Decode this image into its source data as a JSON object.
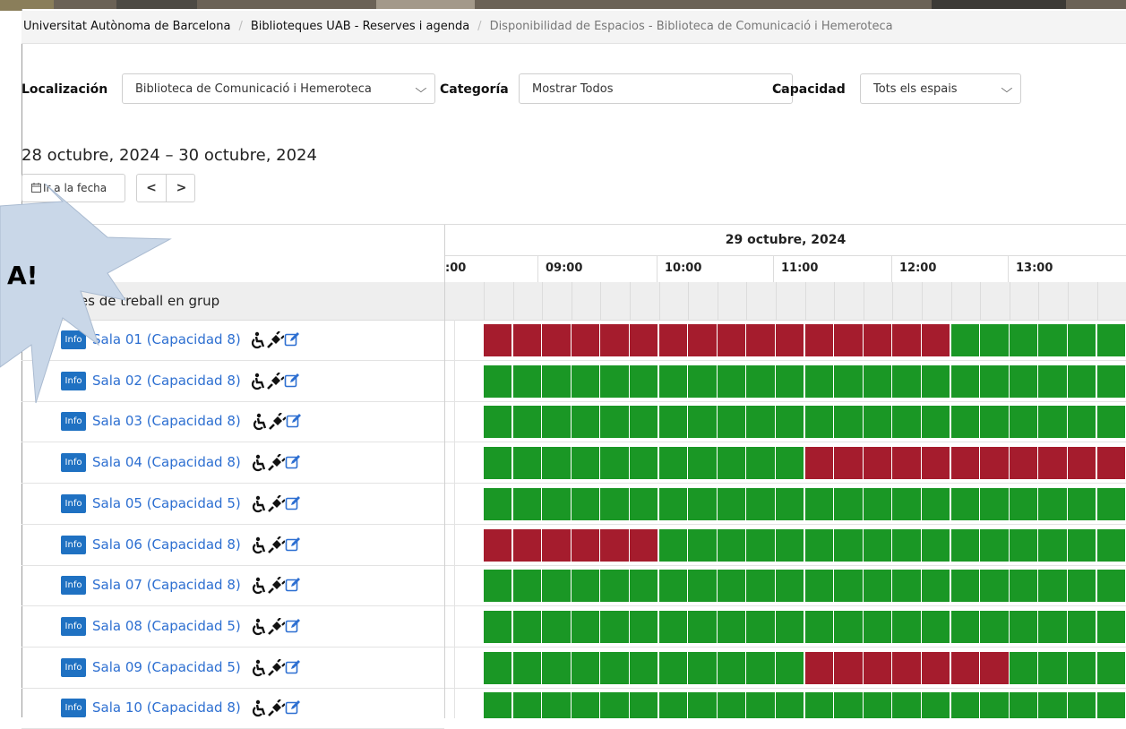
{
  "breadcrumb": {
    "item1": "Universitat Autònoma de Barcelona",
    "item2": "Biblioteques UAB - Reserves i agenda",
    "current": "Disponibilidad de Espacios - Biblioteca de Comunicació i Hemeroteca",
    "separator": "/"
  },
  "filters": {
    "location_label": "Localización",
    "location_value": "Biblioteca de Comunicació i Hemeroteca",
    "category_label": "Categoría",
    "category_value": "Mostrar Todos",
    "capacity_label": "Capacidad",
    "capacity_value": "Tots els espais",
    "chevron": "⌵"
  },
  "date_range": "28 octubre, 2024 – 30 octubre, 2024",
  "toolbar": {
    "goto_label": "Ir a la fecha",
    "prev_label": "<",
    "next_label": ">"
  },
  "timeline": {
    "date": "29 octubre, 2024",
    "hours": [
      ":00",
      "09:00",
      "10:00",
      "11:00",
      "12:00",
      "13:00"
    ]
  },
  "group": {
    "label": "Sales de treball en grup"
  },
  "overlay_text": "A!",
  "colors": {
    "available": "#1a9725",
    "booked": "#a51c2d",
    "info": "#1f71c2",
    "link": "#2d6fd1"
  },
  "info_label": "Info",
  "rooms": [
    {
      "name": "Sala 01 (Capacidad 8)",
      "slots": "BBBBBBBBBBBBBBBBAAAAAA"
    },
    {
      "name": "Sala 02 (Capacidad 8)",
      "slots": "AAAAAAAAAAAAAAAAAAAAAA"
    },
    {
      "name": "Sala 03 (Capacidad 8)",
      "slots": "AAAAAAAAAAAAAAAAAAAAAA"
    },
    {
      "name": "Sala 04 (Capacidad 8)",
      "slots": "AAAAAAAAAAABBBBBBBBBBB"
    },
    {
      "name": "Sala 05 (Capacidad 5)",
      "slots": "AAAAAAAAAAAAAAAAAAAAAA"
    },
    {
      "name": "Sala 06 (Capacidad 8)",
      "slots": "BBBBBBAAAAAAAAAAAAAAAA"
    },
    {
      "name": "Sala 07 (Capacidad 8)",
      "slots": "AAAAAAAAAAAAAAAAAAAAAA"
    },
    {
      "name": "Sala 08 (Capacidad 5)",
      "slots": "AAAAAAAAAAAAAAAAAAAAAA"
    },
    {
      "name": "Sala 09 (Capacidad 5)",
      "slots": "AAAAAAAAAAABBBBBBBAAAA"
    },
    {
      "name": "Sala 10 (Capacidad 8)",
      "slots": "AAAAAAAAAAAAAAAAAAAAAA"
    }
  ]
}
